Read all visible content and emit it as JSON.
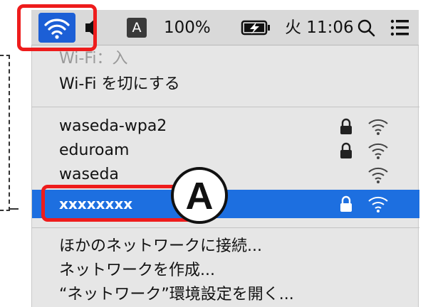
{
  "menubar": {
    "input_mode": "A",
    "battery_percent": "100%",
    "clock": "火 11:06"
  },
  "wifi_menu": {
    "status": "Wi-Fi：入",
    "toggle": "Wi-Fi を切にする",
    "networks": [
      {
        "name": "waseda-wpa2",
        "locked": true
      },
      {
        "name": "eduroam",
        "locked": true
      },
      {
        "name": "waseda",
        "locked": false
      },
      {
        "name": "xxxxxxxx",
        "locked": true,
        "selected": true
      }
    ],
    "actions": {
      "join_other": "ほかのネットワークに接続...",
      "create": "ネットワークを作成...",
      "open_prefs": "“ネットワーク”環境設定を開く..."
    }
  },
  "annotations": {
    "badge_letter": "A",
    "callout_color": "#ee1c1c"
  },
  "colors": {
    "selection": "#1d6fe0",
    "active_icon_bg": "#1c5fd6"
  }
}
